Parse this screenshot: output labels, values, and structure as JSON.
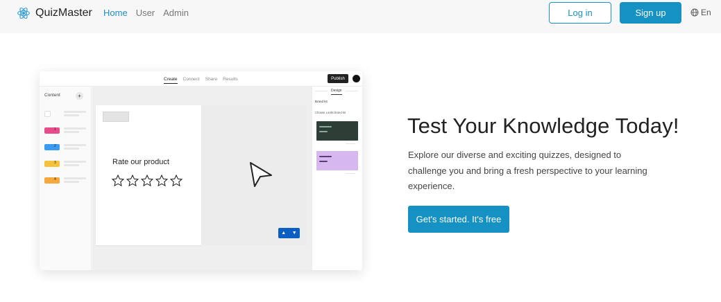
{
  "navbar": {
    "brand": "QuizMaster",
    "links": [
      {
        "label": "Home",
        "active": true
      },
      {
        "label": "User",
        "active": false
      },
      {
        "label": "Admin",
        "active": false
      }
    ],
    "login_label": "Log in",
    "signup_label": "Sign up",
    "language": "En",
    "accent_color": "#1691c4"
  },
  "preview": {
    "tabs": [
      "Create",
      "Connect",
      "Share",
      "Results"
    ],
    "active_tab": "Create",
    "publish_label": "Publish",
    "content_label": "Content",
    "add_symbol": "+",
    "item_numbers": [
      "1",
      "2",
      "3",
      "4"
    ],
    "item_colors": [
      "#e84c8b",
      "#3a9bf0",
      "#f5c33b",
      "#f5a83b"
    ],
    "card_title": "Rate our product",
    "star_count": 5,
    "design_tab": "Design",
    "brand_kit_label": "Brand kit",
    "brand_kit_sub": "Choose Looks brand kit",
    "swatch_colors": [
      "#2c3e35",
      "#d6b8ef"
    ]
  },
  "hero": {
    "title": "Test Your Knowledge Today!",
    "description": "Explore our diverse and exciting quizzes, designed to challenge you and bring a fresh perspective to your learning experience.",
    "cta_label": "Get's started. It's free"
  }
}
